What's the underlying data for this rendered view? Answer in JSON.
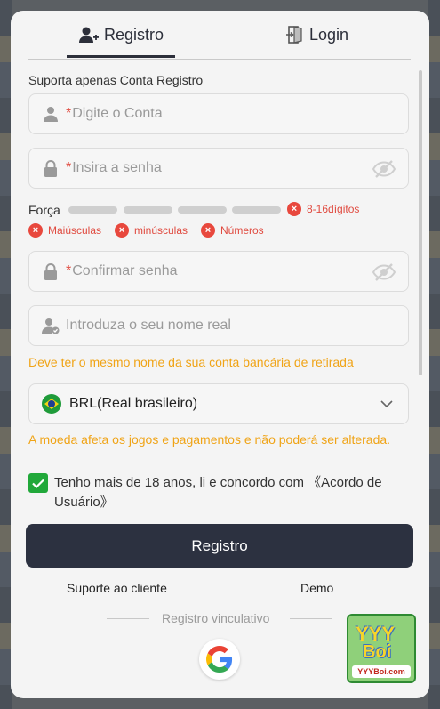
{
  "tabs": {
    "register": "Registro",
    "login": "Login"
  },
  "subtitle": "Suporta apenas Conta Registro",
  "fields": {
    "account_placeholder": "Digite o Conta",
    "password_placeholder": "Insira a senha",
    "confirm_placeholder": "Confirmar senha",
    "realname_placeholder": "Introduza o seu nome real",
    "required_mark": "*"
  },
  "strength": {
    "label": "Força",
    "rules": [
      "8-16dígitos",
      "Maiúsculas",
      "minúsculas",
      "Números"
    ]
  },
  "realname_hint": "Deve ter o mesmo nome da sua conta bancária de retirada",
  "currency": {
    "value": "BRL(Real brasileiro)",
    "hint": "A moeda afeta os jogos e pagamentos e não poderá ser alterada."
  },
  "agreement": {
    "checked": true,
    "text": "Tenho mais de 18 anos, li e concordo com 《Acordo de Usuário》"
  },
  "submit_label": "Registro",
  "links": {
    "support": "Suporte ao cliente",
    "demo": "Demo"
  },
  "binding_label": "Registro vinculativo",
  "logo": {
    "line1": "YYY",
    "line2": "Boi",
    "site": "YYYBoi.com"
  },
  "colors": {
    "primary": "#2c3140",
    "error": "#e8483d",
    "warning": "#f0a417",
    "checkbox": "#21a83a"
  }
}
